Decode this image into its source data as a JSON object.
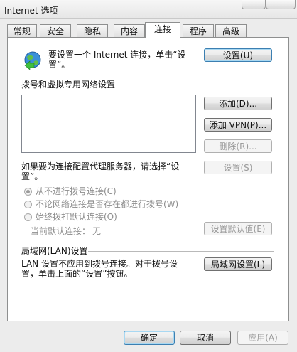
{
  "window": {
    "title": "Internet 选项"
  },
  "tabs": [
    {
      "label": "常规"
    },
    {
      "label": "安全"
    },
    {
      "label": "隐私"
    },
    {
      "label": "内容"
    },
    {
      "label": "连接",
      "active": true
    },
    {
      "label": "程序"
    },
    {
      "label": "高级"
    }
  ],
  "connection": {
    "setup_text_line1": "要设置一个 Internet 连接，单击“设",
    "setup_text_line2": "置”。",
    "setup_button": "设置(U)",
    "setup_icon": "network-globe-icon"
  },
  "dialup": {
    "section_title": "拨号和虚拟专用网络设置",
    "add_button": "添加(D)...",
    "add_vpn_button": "添加 VPN(P)...",
    "remove_button": "删除(R)...",
    "proxy_text_line1": "如果要为连接配置代理服务器，请选择“设",
    "proxy_text_line2": "置”。",
    "settings_button": "设置(S)",
    "radio_options": [
      {
        "label": "从不进行拨号连接(C)",
        "selected": true
      },
      {
        "label": "不论网络连接是否存在都进行拨号(W)",
        "selected": false
      },
      {
        "label": "始终拨打默认连接(O)",
        "selected": false
      }
    ],
    "current_default_label": "当前默认连接：",
    "current_default_value": "无",
    "set_default_button": "设置默认值(E)"
  },
  "lan": {
    "section_title": "局域网(LAN)设置",
    "text_line1": "LAN 设置不应用到拨号连接。对于拨号设",
    "text_line2": "置，单击上面的“设置”按钮。",
    "lan_settings_button": "局域网设置(L)"
  },
  "footer": {
    "ok_button": "确定",
    "cancel_button": "取消",
    "apply_button": "应用(A)"
  }
}
